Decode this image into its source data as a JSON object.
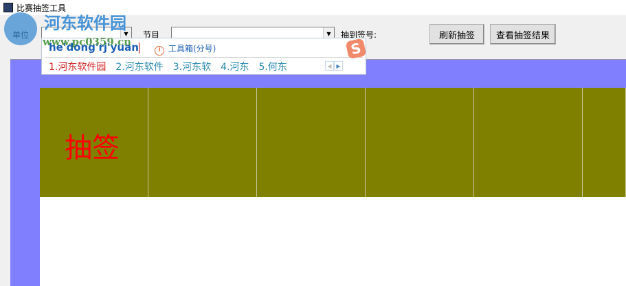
{
  "window": {
    "title": "比赛抽签工具"
  },
  "toolbar": {
    "unit_label": "单位",
    "unit_value": "",
    "program_label": "节目",
    "program_value": "",
    "drawn_number_label": "抽到签号:",
    "refresh_button": "刷新抽签",
    "view_results_button": "查看抽签结果"
  },
  "grid": {
    "cells": [
      "抽签",
      "",
      "",
      "",
      "",
      ""
    ]
  },
  "ime": {
    "pinyin": "he'dong'rj'yuan",
    "toolbox": "工具箱(分号)",
    "candidates": [
      "1.河东软件园",
      "2.河东软件",
      "3.河东软",
      "4.河东",
      "5.何东"
    ],
    "logo": "S"
  },
  "watermark": {
    "name": "河东软件园",
    "url": "www.pc0359.cn"
  }
}
